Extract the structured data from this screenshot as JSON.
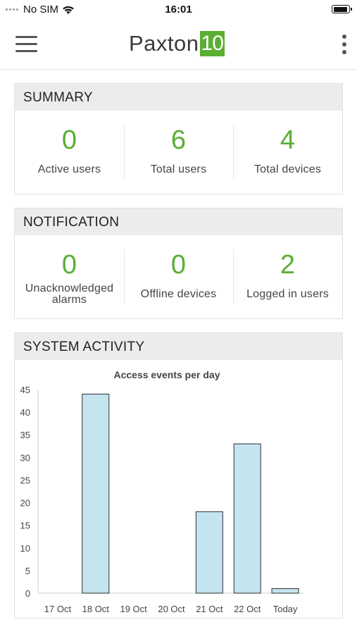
{
  "status_bar": {
    "carrier": "No SIM",
    "time": "16:01"
  },
  "header": {
    "logo_text": "Paxton",
    "logo_badge": "10"
  },
  "summary": {
    "title": "SUMMARY",
    "items": [
      {
        "value": "0",
        "label": "Active users"
      },
      {
        "value": "6",
        "label": "Total users"
      },
      {
        "value": "4",
        "label": "Total devices"
      }
    ]
  },
  "notification": {
    "title": "NOTIFICATION",
    "items": [
      {
        "value": "0",
        "label": "Unacknowledged alarms"
      },
      {
        "value": "0",
        "label": "Offline devices"
      },
      {
        "value": "2",
        "label": "Logged in users"
      }
    ]
  },
  "activity": {
    "title": "SYSTEM ACTIVITY"
  },
  "colors": {
    "accent": "#5aae32",
    "bar_fill": "#c4e4ef",
    "bar_stroke": "#2e2e2e"
  },
  "chart_data": {
    "type": "bar",
    "title": "Access events per day",
    "categories": [
      "17 Oct",
      "18 Oct",
      "19 Oct",
      "20 Oct",
      "21 Oct",
      "22 Oct",
      "Today"
    ],
    "values": [
      0,
      44,
      0,
      0,
      18,
      33,
      1
    ],
    "ylim": [
      0,
      45
    ],
    "yticks": [
      0,
      5,
      10,
      15,
      20,
      25,
      30,
      35,
      40,
      45
    ],
    "grid": false,
    "xlabel": "",
    "ylabel": ""
  }
}
